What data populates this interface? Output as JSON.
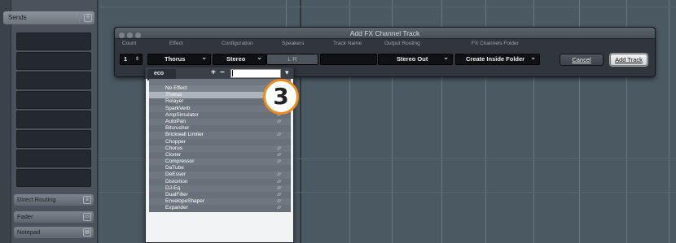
{
  "left_panel": {
    "header_label": "Sends",
    "buttons": [
      {
        "label": "Direct Routing"
      },
      {
        "label": "Fader"
      },
      {
        "label": "Notepad"
      }
    ]
  },
  "dialog": {
    "title": "Add FX Channel Track",
    "columns": [
      "Count",
      "Effect",
      "Configuration",
      "Speakers",
      "Track Name",
      "Output Routing",
      "FX Channels Folder"
    ],
    "count_value": "1",
    "effect_value": "Thorus",
    "configuration_value": "Stereo",
    "speakers_value": "L R",
    "track_name_value": "",
    "output_routing_value": "Stereo Out",
    "folder_value": "Create Inside Folder",
    "cancel_label": "Cancel",
    "add_label": "Add Track"
  },
  "popup": {
    "tab_label": "eco",
    "plus": "+",
    "minus": "−",
    "search_value": "",
    "items": [
      {
        "label": "No Effect",
        "tag": ""
      },
      {
        "label": "Thorus",
        "tag": ""
      },
      {
        "label": "Relayer",
        "tag": ""
      },
      {
        "label": "SparkVerb",
        "tag": ""
      },
      {
        "label": "AmpSimulator",
        "tag": "///"
      },
      {
        "label": "AutoPan",
        "tag": "///"
      },
      {
        "label": "Bitcrusher",
        "tag": ""
      },
      {
        "label": "Brickwall Limiter",
        "tag": "///"
      },
      {
        "label": "Chopper",
        "tag": ""
      },
      {
        "label": "Chorus",
        "tag": "///"
      },
      {
        "label": "Cloner",
        "tag": "///"
      },
      {
        "label": "Compressor",
        "tag": "///"
      },
      {
        "label": "DaTube",
        "tag": ""
      },
      {
        "label": "DeEsser",
        "tag": "///"
      },
      {
        "label": "Distortion",
        "tag": "///"
      },
      {
        "label": "DJ-Eq",
        "tag": "///"
      },
      {
        "label": "DualFilter",
        "tag": "///"
      },
      {
        "label": "EnvelopeShaper",
        "tag": "///"
      },
      {
        "label": "Expander",
        "tag": "///"
      }
    ],
    "selected_index": 1
  },
  "callout_number": "3"
}
